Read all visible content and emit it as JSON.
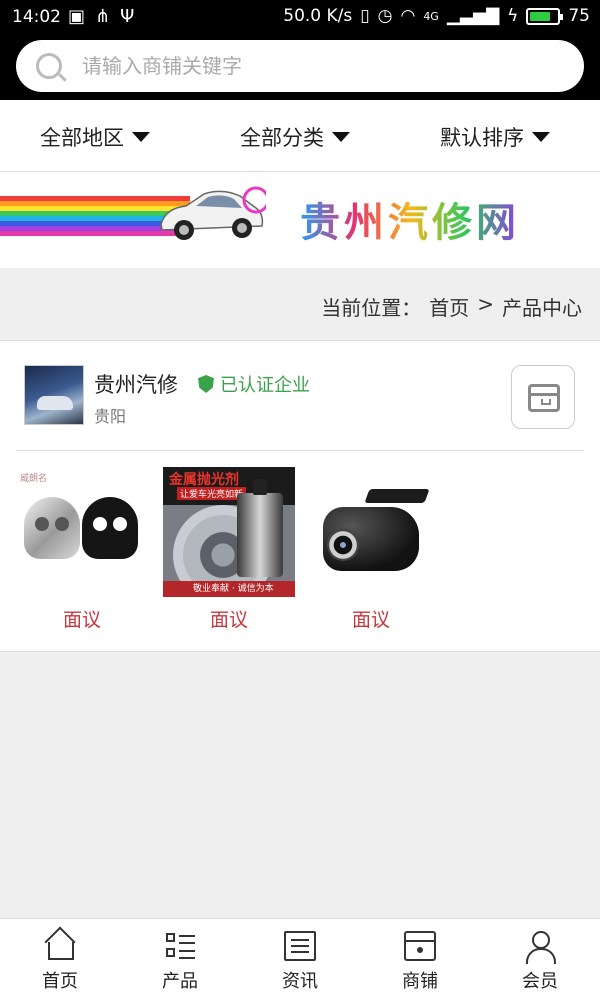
{
  "status_bar": {
    "time": "14:02",
    "speed": "50.0 K/s",
    "network": "4G",
    "battery": "75",
    "battery_level": 0.75
  },
  "search": {
    "placeholder": "请输入商铺关键字"
  },
  "filters": [
    {
      "label": "全部地区"
    },
    {
      "label": "全部分类"
    },
    {
      "label": "默认排序"
    }
  ],
  "banner": {
    "title": "贵州汽修网"
  },
  "breadcrumb": {
    "prefix": "当前位置：",
    "home": "首页",
    "separator": ">",
    "current": "产品中心"
  },
  "shop": {
    "name": "贵州汽修",
    "verified_label": "已认证企业",
    "city": "贵阳",
    "products": [
      {
        "price": "面议",
        "image": "skull-emblem-image"
      },
      {
        "price": "面议",
        "image": "car-polish-image"
      },
      {
        "price": "面议",
        "image": "dash-camera-image"
      }
    ]
  },
  "bottom_nav": [
    {
      "label": "首页",
      "icon": "home-icon"
    },
    {
      "label": "产品",
      "icon": "product-list-icon"
    },
    {
      "label": "资讯",
      "icon": "news-icon"
    },
    {
      "label": "商铺",
      "icon": "store-icon"
    },
    {
      "label": "会员",
      "icon": "user-icon"
    }
  ],
  "colors": {
    "accent_price": "#c7383e",
    "verified": "#3aa24a",
    "battery_fill": "#2ecc40"
  }
}
